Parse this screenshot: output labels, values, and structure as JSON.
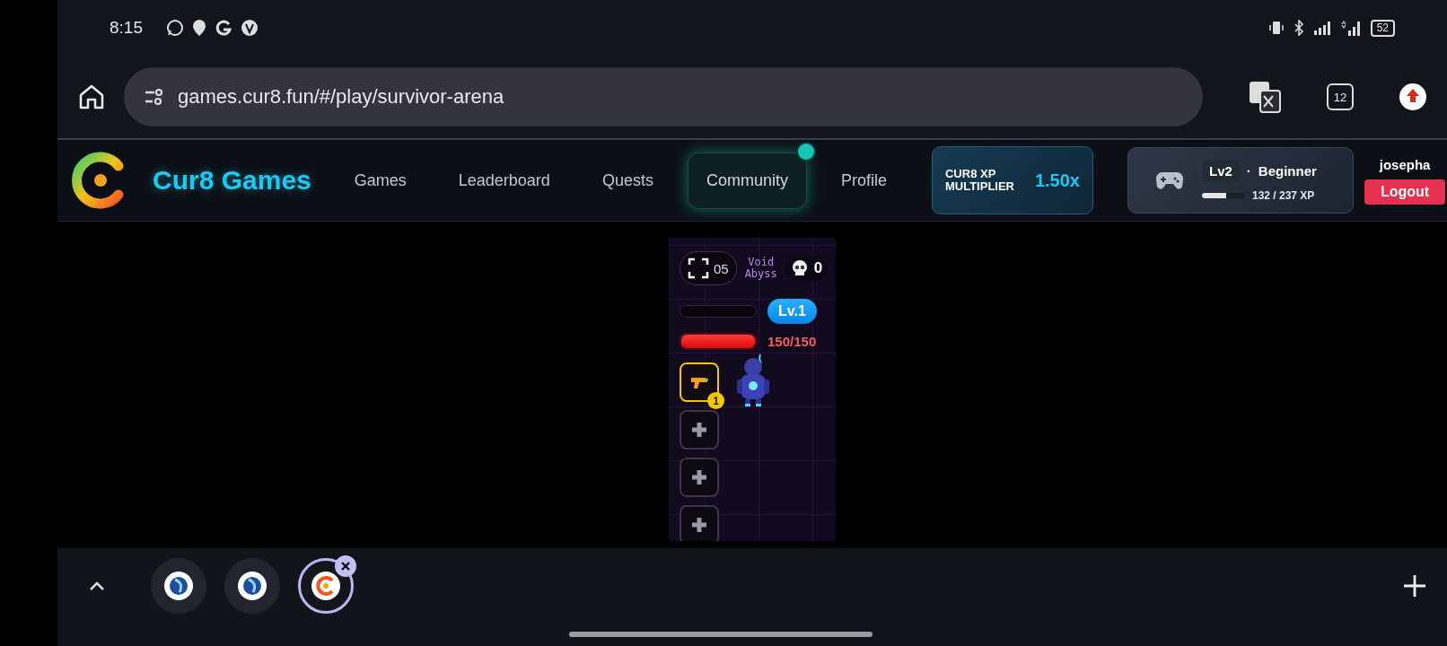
{
  "status_bar": {
    "time": "8:15",
    "battery": "52"
  },
  "browser": {
    "url": "games.cur8.fun/#/play/survivor-arena",
    "tab_count": "12"
  },
  "site_header": {
    "brand": "Cur8 Games",
    "nav": [
      {
        "label": "Games",
        "selected": false,
        "notification": false
      },
      {
        "label": "Leaderboard",
        "selected": false,
        "notification": false
      },
      {
        "label": "Quests",
        "selected": false,
        "notification": false
      },
      {
        "label": "Community",
        "selected": true,
        "notification": true
      },
      {
        "label": "Profile",
        "selected": false,
        "notification": false
      }
    ],
    "xp_multiplier": {
      "label": "CUR8 XP MULTIPLIER",
      "value": "1.50x"
    },
    "player": {
      "level": "Lv2",
      "separator": "·",
      "rank": "Beginner",
      "xp": "132 / 237 XP",
      "level_progress": {
        "level": 0.56
      }
    },
    "username": "josepha",
    "logout": "Logout"
  },
  "game": {
    "title": "Void Abyss",
    "timer": "05",
    "kills": "0",
    "player_level": "Lv.1",
    "xp_bar": {
      "level": 0
    },
    "health_bar": {
      "level": 1
    },
    "health": "150/150",
    "slots": [
      {
        "kind": "weapon",
        "badge": "1"
      },
      {
        "kind": "empty"
      },
      {
        "kind": "empty"
      },
      {
        "kind": "empty"
      }
    ]
  },
  "tabs": [
    {
      "selected": false
    },
    {
      "selected": false
    },
    {
      "selected": true
    }
  ]
}
